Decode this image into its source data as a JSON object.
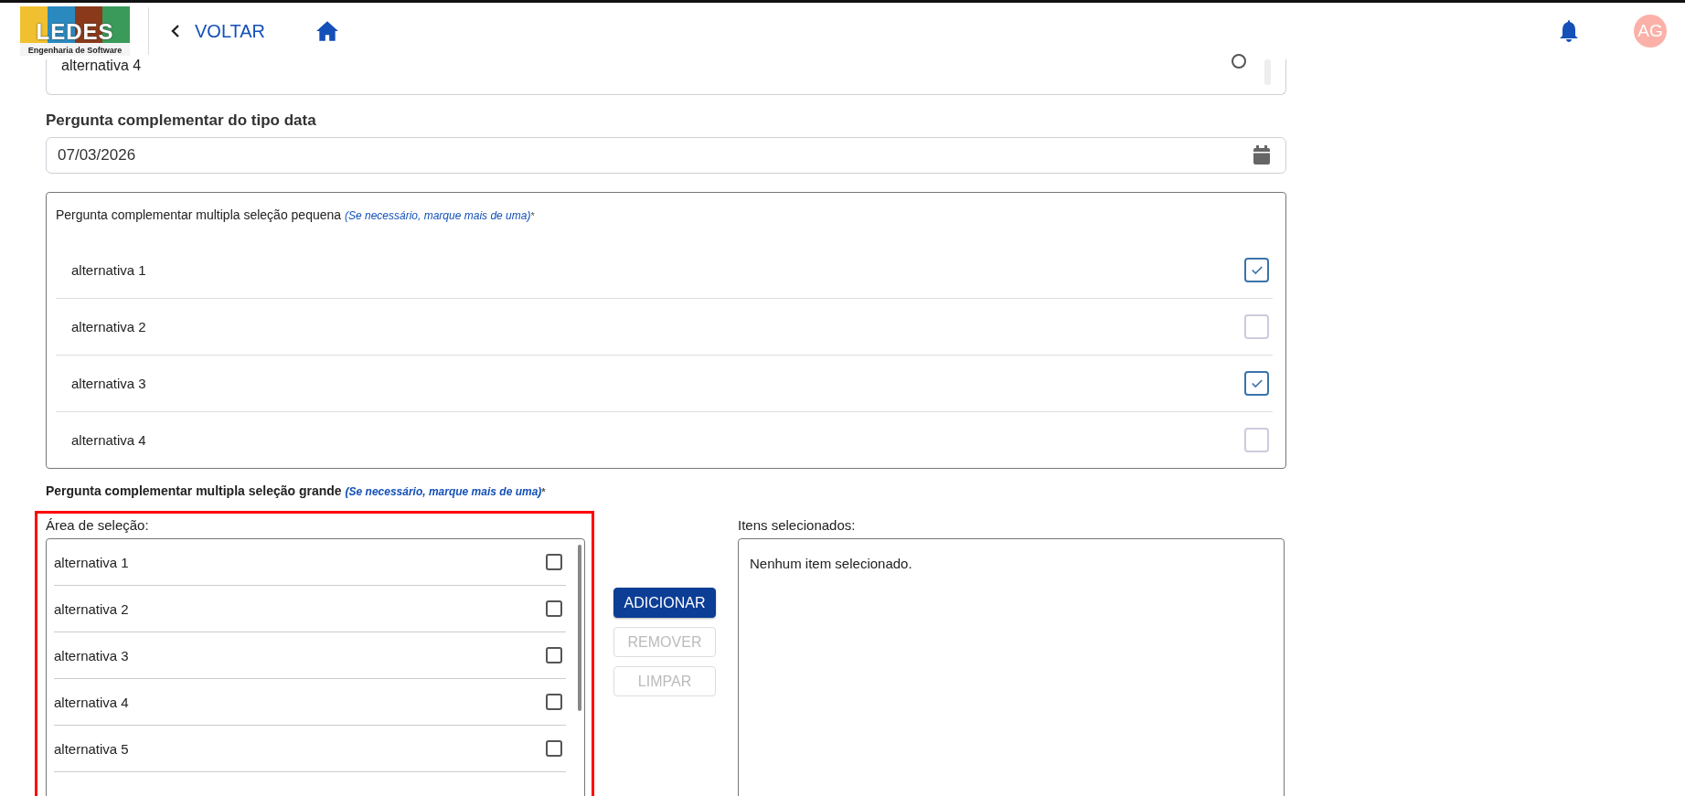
{
  "header": {
    "logo_text": "LEDES",
    "logo_subtitle": "Engenharia de Software",
    "back_label": "VOLTAR",
    "avatar_initials": "AG"
  },
  "prev_question": {
    "option": "alternativa 4",
    "selected": false
  },
  "date_question": {
    "label": "Pergunta complementar do tipo data",
    "value": "07/03/2026"
  },
  "small_multi": {
    "title": "Pergunta complementar multipla seleção pequena",
    "hint": "(Se necessário, marque mais de uma)",
    "required_mark": "*",
    "options": [
      {
        "label": "alternativa 1",
        "checked": true
      },
      {
        "label": "alternativa 2",
        "checked": false
      },
      {
        "label": "alternativa 3",
        "checked": true
      },
      {
        "label": "alternativa 4",
        "checked": false
      }
    ]
  },
  "large_multi": {
    "title": "Pergunta complementar multipla seleção grande",
    "hint": "(Se necessário, marque mais de uma)",
    "required_mark": "*",
    "highlighted": true,
    "selection_area": {
      "label": "Área de seleção:",
      "options": [
        {
          "label": "alternativa 1",
          "checked": false
        },
        {
          "label": "alternativa 2",
          "checked": false
        },
        {
          "label": "alternativa 3",
          "checked": false
        },
        {
          "label": "alternativa 4",
          "checked": false
        },
        {
          "label": "alternativa 5",
          "checked": false
        }
      ]
    },
    "buttons": [
      {
        "label": "ADICIONAR",
        "disabled": false
      },
      {
        "label": "REMOVER",
        "disabled": true
      },
      {
        "label": "LIMPAR",
        "disabled": true
      }
    ],
    "selected_area": {
      "label": "Itens selecionados:",
      "empty_text": "Nenhum item selecionado."
    }
  }
}
